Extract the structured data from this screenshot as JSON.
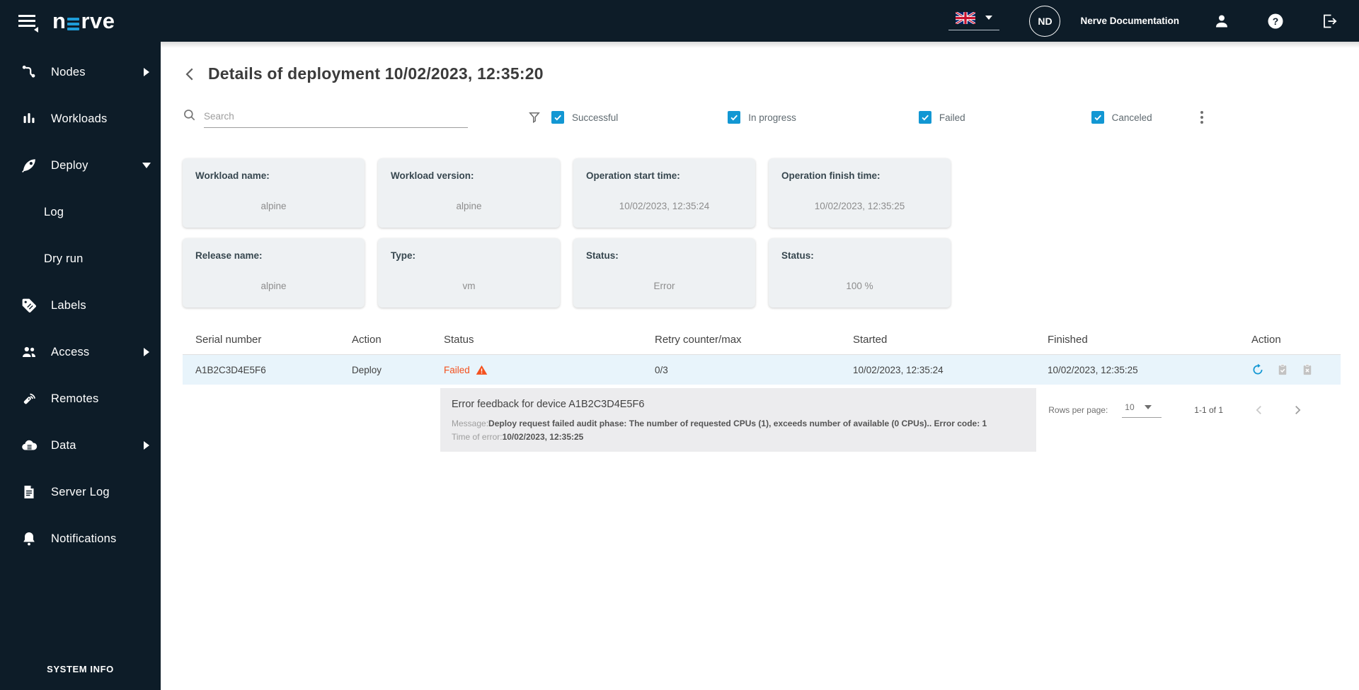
{
  "topbar": {
    "brand_prefix": "n",
    "brand_suffix": "rve",
    "avatar_initials": "ND",
    "docs_label": "Nerve Documentation"
  },
  "sidebar": {
    "items": [
      {
        "label": "Nodes"
      },
      {
        "label": "Workloads"
      },
      {
        "label": "Deploy"
      },
      {
        "label": "Log"
      },
      {
        "label": "Dry run"
      },
      {
        "label": "Labels"
      },
      {
        "label": "Access"
      },
      {
        "label": "Remotes"
      },
      {
        "label": "Data"
      },
      {
        "label": "Server Log"
      },
      {
        "label": "Notifications"
      }
    ],
    "footer": "SYSTEM INFO"
  },
  "header": {
    "title": "Details of deployment 10/02/2023, 12:35:20"
  },
  "filters": {
    "search_placeholder": "Search",
    "checkboxes": [
      {
        "label": "Successful",
        "checked": true
      },
      {
        "label": "In progress",
        "checked": true
      },
      {
        "label": "Failed",
        "checked": true
      },
      {
        "label": "Canceled",
        "checked": true
      }
    ]
  },
  "cards": [
    {
      "label": "Workload name:",
      "value": "alpine"
    },
    {
      "label": "Workload version:",
      "value": "alpine"
    },
    {
      "label": "Operation start time:",
      "value": "10/02/2023, 12:35:24"
    },
    {
      "label": "Operation finish time:",
      "value": "10/02/2023, 12:35:25"
    },
    {
      "label": "Release name:",
      "value": "alpine"
    },
    {
      "label": "Type:",
      "value": "vm"
    },
    {
      "label": "Status:",
      "value": "Error"
    },
    {
      "label": "Status:",
      "value": "100 %"
    }
  ],
  "table": {
    "columns": [
      "Serial number",
      "Action",
      "Status",
      "Retry counter/max",
      "Started",
      "Finished",
      "Action"
    ],
    "rows": [
      {
        "serial": "A1B2C3D4E5F6",
        "action": "Deploy",
        "status": "Failed",
        "retry": "0/3",
        "started": "10/02/2023, 12:35:24",
        "finished": "10/02/2023, 12:35:25"
      }
    ]
  },
  "error_feedback": {
    "title": "Error feedback for device A1B2C3D4E5F6",
    "message_label": "Message:",
    "message": "Deploy request failed audit phase: The number of requested CPUs (1), exceeds number of available (0 CPUs).. Error code: 1",
    "time_label": "Time of error:",
    "time": "10/02/2023, 12:35:25"
  },
  "pagination": {
    "rows_per_page_label": "Rows per page:",
    "rows_per_page": "10",
    "range": "1-1 of 1"
  },
  "colors": {
    "dark_navy": "#0d1c28",
    "accent_blue": "#1297d3",
    "logo_blue": "#1e9cd7",
    "failed_orange": "#f4511e",
    "row_highlight": "#e8f4fb",
    "card_bg": "#eef1f3",
    "error_panel_bg": "#ececee"
  }
}
